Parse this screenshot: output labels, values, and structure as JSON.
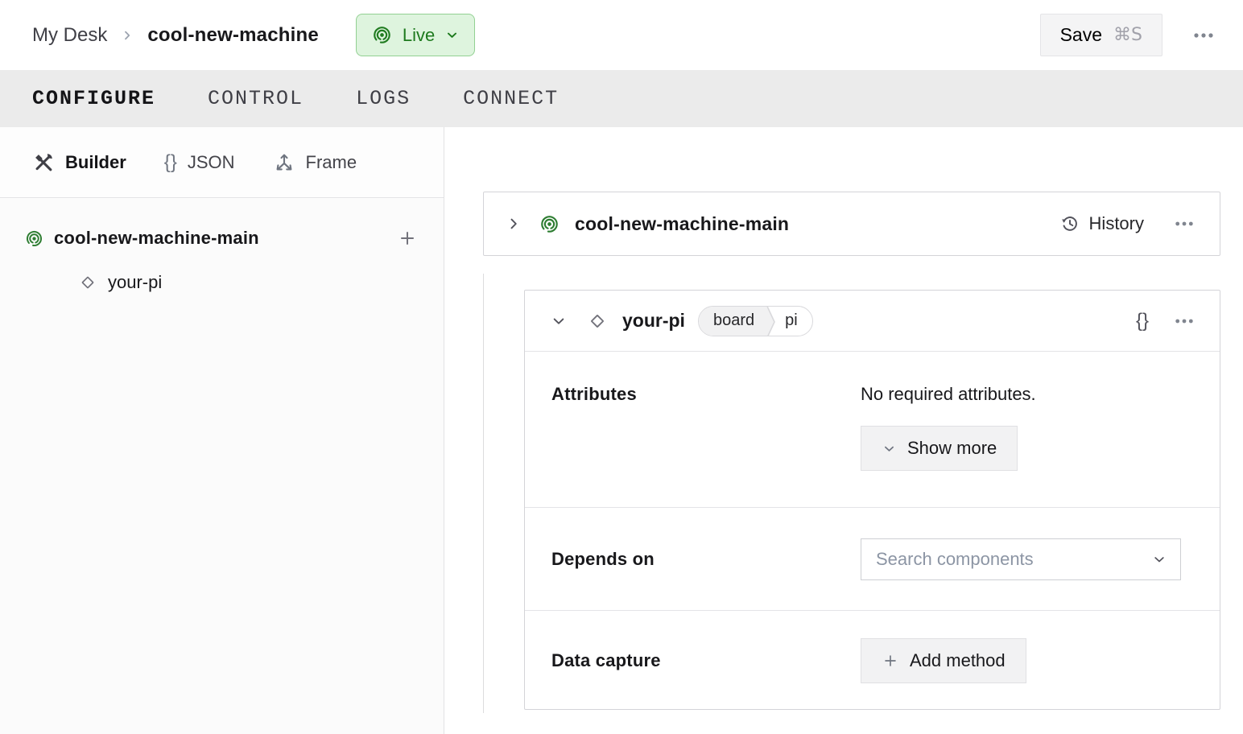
{
  "topbar": {
    "breadcrumb": {
      "parent": "My Desk",
      "current": "cool-new-machine"
    },
    "live_label": "Live",
    "save_label": "Save",
    "save_shortcut": "⌘S"
  },
  "tabs": [
    {
      "label": "CONFIGURE",
      "active": true
    },
    {
      "label": "CONTROL",
      "active": false
    },
    {
      "label": "LOGS",
      "active": false
    },
    {
      "label": "CONNECT",
      "active": false
    }
  ],
  "sidebar": {
    "views": [
      {
        "label": "Builder",
        "icon": "tools-icon",
        "active": true
      },
      {
        "label": "JSON",
        "icon": "braces-icon",
        "active": false
      },
      {
        "label": "Frame",
        "icon": "frame-axes-icon",
        "active": false
      }
    ],
    "tree": {
      "root_label": "cool-new-machine-main",
      "child_label": "your-pi"
    }
  },
  "main": {
    "machine_card": {
      "title": "cool-new-machine-main",
      "history_label": "History"
    },
    "component_card": {
      "title": "your-pi",
      "badge": {
        "type": "board",
        "model": "pi"
      },
      "sections": {
        "attributes": {
          "label": "Attributes",
          "empty_text": "No required attributes.",
          "show_more_label": "Show more"
        },
        "depends_on": {
          "label": "Depends on",
          "placeholder": "Search components"
        },
        "data_capture": {
          "label": "Data capture",
          "add_method_label": "Add method"
        }
      }
    }
  },
  "glyphs": {
    "braces": "{}"
  },
  "icons": {
    "live_status": "broadcast-icon",
    "builder_view": "tools-icon",
    "json_view": "braces-icon",
    "frame_view": "frame-axes-icon",
    "component": "diamond-icon",
    "history": "history-clock-icon",
    "menu": "ellipsis-icon"
  },
  "colors": {
    "accent_green": "#2E7D32",
    "live_badge_bg": "#DEF4DE",
    "live_badge_border": "#92D092",
    "live_badge_text": "#1E7A1E",
    "tab_bar_bg": "#EBEBEB",
    "placeholder_text": "#8C95A4"
  }
}
